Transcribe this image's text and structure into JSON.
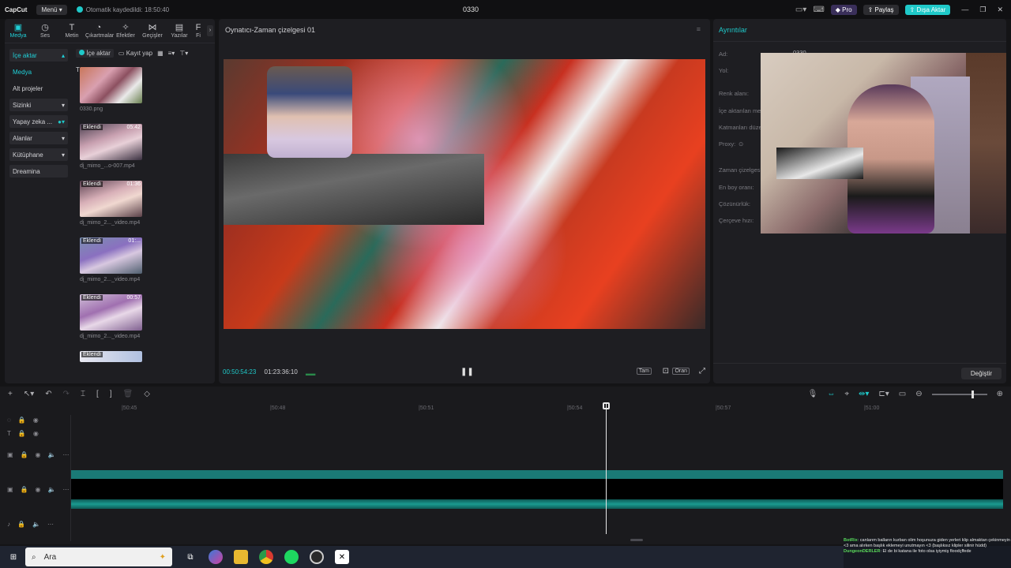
{
  "app": {
    "logo": "CapCut",
    "menu_label": "Menü",
    "autosave": "Otomatik kaydedildi: 18:50:40",
    "project_name": "0330"
  },
  "titlebar": {
    "pro_label": "Pro",
    "share_label": "Paylaş",
    "export_label": "Dışa Aktar"
  },
  "tabs": [
    {
      "label": "Medya",
      "icon": "media-icon"
    },
    {
      "label": "Ses",
      "icon": "audio-icon"
    },
    {
      "label": "Metin",
      "icon": "text-icon"
    },
    {
      "label": "Çıkartmalar",
      "icon": "sticker-icon"
    },
    {
      "label": "Efektler",
      "icon": "effects-icon"
    },
    {
      "label": "Geçişler",
      "icon": "transitions-icon"
    },
    {
      "label": "Yazılar",
      "icon": "captions-icon"
    },
    {
      "label": "Fi",
      "icon": "filters-icon"
    }
  ],
  "side_nav": [
    {
      "label": "İçe aktar"
    },
    {
      "label": "Medya"
    },
    {
      "label": "Alt projeler"
    },
    {
      "label": "Sizinki"
    },
    {
      "label": "Yapay zeka ..."
    },
    {
      "label": "Alanlar"
    },
    {
      "label": "Kütüphane"
    },
    {
      "label": "Dreamina"
    }
  ],
  "media": {
    "import_label": "İçe aktar",
    "record_label": "Kayıt yap",
    "section_label": "Tümü",
    "items": [
      {
        "name": "0330.png",
        "tag": "",
        "duration": ""
      },
      {
        "name": "dj_mimo_...o-007.mp4",
        "tag": "Eklendi",
        "duration": "05:42"
      },
      {
        "name": "dj_mimo_2..._video.mp4",
        "tag": "Eklendi",
        "duration": "01:36"
      },
      {
        "name": "dj_mimo_2..._video.mp4",
        "tag": "Eklendi",
        "duration": "01:..."
      },
      {
        "name": "dj_mimo_2..._video.mp4",
        "tag": "Eklendi",
        "duration": "00:57"
      },
      {
        "name": "",
        "tag": "Eklendi",
        "duration": ""
      }
    ]
  },
  "player": {
    "title": "Oynatıcı-Zaman çizelgesi 01",
    "current_time": "00:50:54:23",
    "total_time": "01:23:36:10",
    "full_label": "Tam",
    "ratio_label": "Oran"
  },
  "details": {
    "title": "Ayrıntılar",
    "name_label": "Ad:",
    "name_value": "0330",
    "path_label": "Yol:",
    "color_label": "Renk alanı:",
    "import_label": "İçe aktarılan me",
    "layer_label": "Katmanları düze",
    "proxy_label": "Proxy:",
    "timeline_label": "Zaman çizelges",
    "aspect_label": "En boy oranı:",
    "resolution_label": "Çözünürlük:",
    "fps_label": "Çerçeve hızı:",
    "change_label": "Değiştir"
  },
  "timeline": {
    "ruler": [
      "|50:45",
      "|50:48",
      "|50:51",
      "|50:54",
      "|50:57",
      "|51:00"
    ]
  },
  "taskbar": {
    "search_placeholder": "Ara",
    "chat1_user": "BotRix",
    "chat1_text": ": canlarım balların kurban olim hoşunuza giden yerleri klip almaktan çekinmeyin <3 ama alırken başlık eklemeyi unutmayın <3 (başlıksız klipler silinir hüdd)",
    "chat2_user": "DungeonDERLER",
    "chat2_text": ": El de bi katana ile foto olsa iyiymiş floodçffede"
  },
  "colors": {
    "accent": "#1fc9c9",
    "bg": "#141416",
    "panel": "#1e1e22"
  }
}
